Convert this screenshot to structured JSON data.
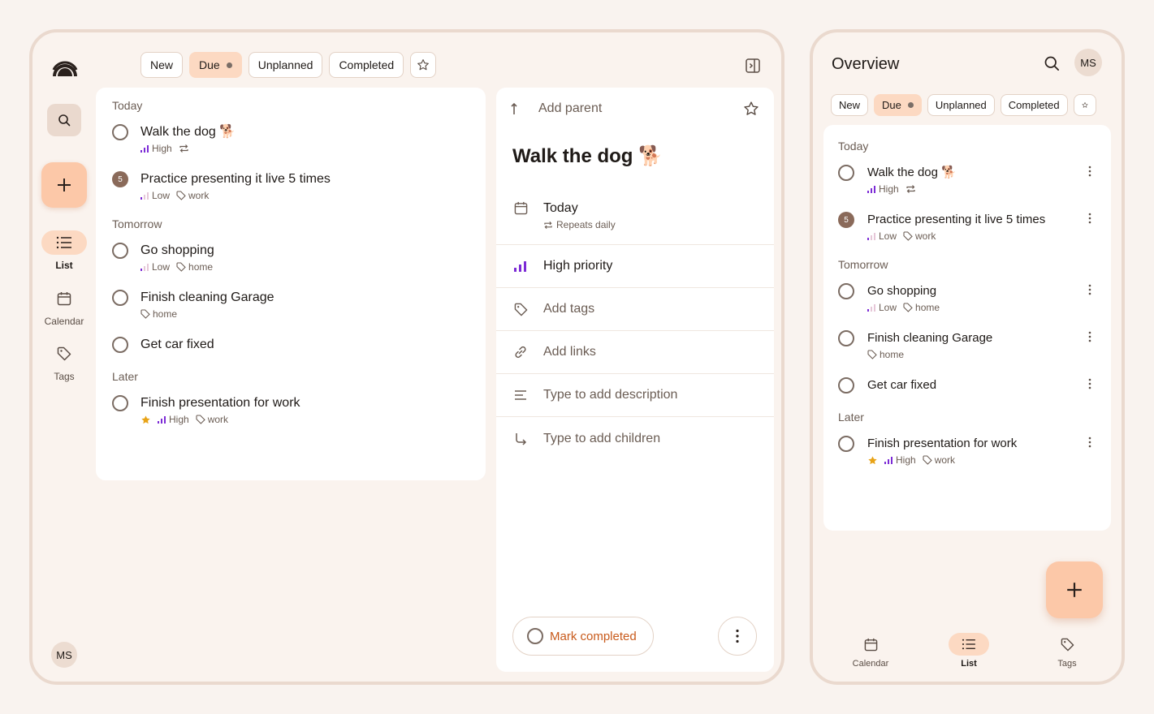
{
  "colors": {
    "accent": "#fcc8a8",
    "accent_soft": "#fcd9c2",
    "background": "#faf3ee",
    "border": "#ead9ce",
    "priority_high": "#7c2bd6",
    "star": "#e8a317",
    "mark_text": "#c85a1b"
  },
  "filters": [
    {
      "label": "New",
      "active": false
    },
    {
      "label": "Due",
      "active": true
    },
    {
      "label": "Unplanned",
      "active": false
    },
    {
      "label": "Completed",
      "active": false
    }
  ],
  "sidebar": {
    "nav": [
      {
        "label": "List",
        "icon": "list-icon",
        "active": true
      },
      {
        "label": "Calendar",
        "icon": "calendar-icon",
        "active": false
      },
      {
        "label": "Tags",
        "icon": "tag-icon",
        "active": false
      }
    ],
    "avatar": "MS"
  },
  "sections": [
    {
      "label": "Today",
      "tasks": [
        {
          "title": "Walk the dog 🐕",
          "priority": "High",
          "repeat": true,
          "tags": []
        },
        {
          "title": "Practice presenting it live 5 times",
          "count": "5",
          "priority": "Low",
          "tags": [
            "work"
          ]
        }
      ]
    },
    {
      "label": "Tomorrow",
      "tasks": [
        {
          "title": "Go shopping",
          "priority": "Low",
          "tags": [
            "home"
          ]
        },
        {
          "title": "Finish cleaning Garage",
          "tags": [
            "home"
          ]
        },
        {
          "title": "Get car fixed",
          "tags": []
        }
      ]
    },
    {
      "label": "Later",
      "tasks": [
        {
          "title": "Finish presentation for work",
          "starred": true,
          "priority": "High",
          "tags": [
            "work"
          ]
        }
      ]
    }
  ],
  "detail": {
    "add_parent": "Add parent",
    "title": "Walk the dog 🐕",
    "date": "Today",
    "repeat": "Repeats daily",
    "priority": "High priority",
    "add_tags": "Add tags",
    "add_links": "Add links",
    "description_placeholder": "Type to add description",
    "children_placeholder": "Type to add children",
    "mark_completed": "Mark completed"
  },
  "mobile": {
    "title": "Overview",
    "avatar": "MS",
    "tabs": [
      {
        "label": "Calendar",
        "icon": "calendar-icon",
        "active": false
      },
      {
        "label": "List",
        "icon": "list-icon",
        "active": true
      },
      {
        "label": "Tags",
        "icon": "tag-icon",
        "active": false
      }
    ]
  }
}
